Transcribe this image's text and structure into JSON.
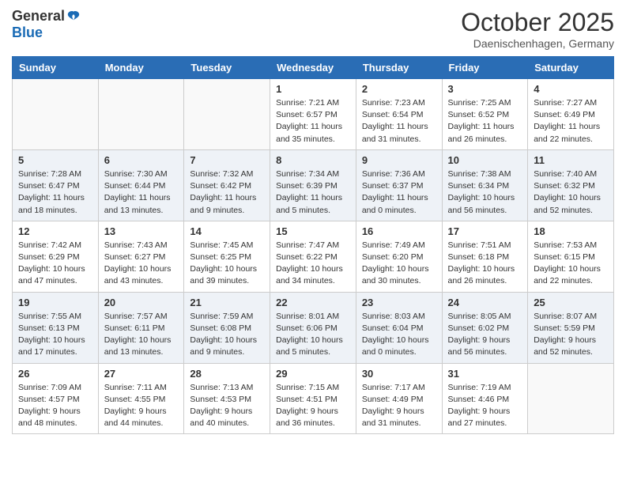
{
  "header": {
    "logo_general": "General",
    "logo_blue": "Blue",
    "month_title": "October 2025",
    "location": "Daenischenhagen, Germany"
  },
  "calendar": {
    "columns": [
      "Sunday",
      "Monday",
      "Tuesday",
      "Wednesday",
      "Thursday",
      "Friday",
      "Saturday"
    ],
    "weeks": [
      [
        {
          "day": "",
          "info": ""
        },
        {
          "day": "",
          "info": ""
        },
        {
          "day": "",
          "info": ""
        },
        {
          "day": "1",
          "info": "Sunrise: 7:21 AM\nSunset: 6:57 PM\nDaylight: 11 hours\nand 35 minutes."
        },
        {
          "day": "2",
          "info": "Sunrise: 7:23 AM\nSunset: 6:54 PM\nDaylight: 11 hours\nand 31 minutes."
        },
        {
          "day": "3",
          "info": "Sunrise: 7:25 AM\nSunset: 6:52 PM\nDaylight: 11 hours\nand 26 minutes."
        },
        {
          "day": "4",
          "info": "Sunrise: 7:27 AM\nSunset: 6:49 PM\nDaylight: 11 hours\nand 22 minutes."
        }
      ],
      [
        {
          "day": "5",
          "info": "Sunrise: 7:28 AM\nSunset: 6:47 PM\nDaylight: 11 hours\nand 18 minutes."
        },
        {
          "day": "6",
          "info": "Sunrise: 7:30 AM\nSunset: 6:44 PM\nDaylight: 11 hours\nand 13 minutes."
        },
        {
          "day": "7",
          "info": "Sunrise: 7:32 AM\nSunset: 6:42 PM\nDaylight: 11 hours\nand 9 minutes."
        },
        {
          "day": "8",
          "info": "Sunrise: 7:34 AM\nSunset: 6:39 PM\nDaylight: 11 hours\nand 5 minutes."
        },
        {
          "day": "9",
          "info": "Sunrise: 7:36 AM\nSunset: 6:37 PM\nDaylight: 11 hours\nand 0 minutes."
        },
        {
          "day": "10",
          "info": "Sunrise: 7:38 AM\nSunset: 6:34 PM\nDaylight: 10 hours\nand 56 minutes."
        },
        {
          "day": "11",
          "info": "Sunrise: 7:40 AM\nSunset: 6:32 PM\nDaylight: 10 hours\nand 52 minutes."
        }
      ],
      [
        {
          "day": "12",
          "info": "Sunrise: 7:42 AM\nSunset: 6:29 PM\nDaylight: 10 hours\nand 47 minutes."
        },
        {
          "day": "13",
          "info": "Sunrise: 7:43 AM\nSunset: 6:27 PM\nDaylight: 10 hours\nand 43 minutes."
        },
        {
          "day": "14",
          "info": "Sunrise: 7:45 AM\nSunset: 6:25 PM\nDaylight: 10 hours\nand 39 minutes."
        },
        {
          "day": "15",
          "info": "Sunrise: 7:47 AM\nSunset: 6:22 PM\nDaylight: 10 hours\nand 34 minutes."
        },
        {
          "day": "16",
          "info": "Sunrise: 7:49 AM\nSunset: 6:20 PM\nDaylight: 10 hours\nand 30 minutes."
        },
        {
          "day": "17",
          "info": "Sunrise: 7:51 AM\nSunset: 6:18 PM\nDaylight: 10 hours\nand 26 minutes."
        },
        {
          "day": "18",
          "info": "Sunrise: 7:53 AM\nSunset: 6:15 PM\nDaylight: 10 hours\nand 22 minutes."
        }
      ],
      [
        {
          "day": "19",
          "info": "Sunrise: 7:55 AM\nSunset: 6:13 PM\nDaylight: 10 hours\nand 17 minutes."
        },
        {
          "day": "20",
          "info": "Sunrise: 7:57 AM\nSunset: 6:11 PM\nDaylight: 10 hours\nand 13 minutes."
        },
        {
          "day": "21",
          "info": "Sunrise: 7:59 AM\nSunset: 6:08 PM\nDaylight: 10 hours\nand 9 minutes."
        },
        {
          "day": "22",
          "info": "Sunrise: 8:01 AM\nSunset: 6:06 PM\nDaylight: 10 hours\nand 5 minutes."
        },
        {
          "day": "23",
          "info": "Sunrise: 8:03 AM\nSunset: 6:04 PM\nDaylight: 10 hours\nand 0 minutes."
        },
        {
          "day": "24",
          "info": "Sunrise: 8:05 AM\nSunset: 6:02 PM\nDaylight: 9 hours\nand 56 minutes."
        },
        {
          "day": "25",
          "info": "Sunrise: 8:07 AM\nSunset: 5:59 PM\nDaylight: 9 hours\nand 52 minutes."
        }
      ],
      [
        {
          "day": "26",
          "info": "Sunrise: 7:09 AM\nSunset: 4:57 PM\nDaylight: 9 hours\nand 48 minutes."
        },
        {
          "day": "27",
          "info": "Sunrise: 7:11 AM\nSunset: 4:55 PM\nDaylight: 9 hours\nand 44 minutes."
        },
        {
          "day": "28",
          "info": "Sunrise: 7:13 AM\nSunset: 4:53 PM\nDaylight: 9 hours\nand 40 minutes."
        },
        {
          "day": "29",
          "info": "Sunrise: 7:15 AM\nSunset: 4:51 PM\nDaylight: 9 hours\nand 36 minutes."
        },
        {
          "day": "30",
          "info": "Sunrise: 7:17 AM\nSunset: 4:49 PM\nDaylight: 9 hours\nand 31 minutes."
        },
        {
          "day": "31",
          "info": "Sunrise: 7:19 AM\nSunset: 4:46 PM\nDaylight: 9 hours\nand 27 minutes."
        },
        {
          "day": "",
          "info": ""
        }
      ]
    ]
  }
}
